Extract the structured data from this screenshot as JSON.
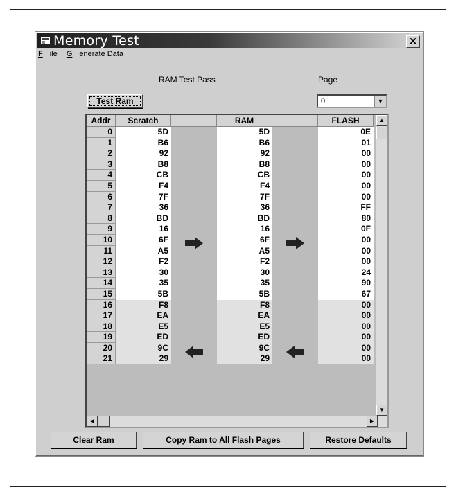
{
  "window": {
    "title": "Memory Test",
    "close_glyph": "×"
  },
  "menu": {
    "file": "File",
    "generate": "Generate Data"
  },
  "labels": {
    "ram_test_pass": "RAM Test Pass",
    "page": "Page"
  },
  "buttons": {
    "test_ram": "Test Ram",
    "clear_ram": "Clear Ram",
    "copy_ram": "Copy Ram to All Flash Pages",
    "restore_defaults": "Restore Defaults"
  },
  "page_select": {
    "value": "0"
  },
  "grid": {
    "headers": {
      "addr": "Addr",
      "scratch": "Scratch",
      "ram": "RAM",
      "flash": "FLASH"
    },
    "rows": [
      {
        "addr": "0",
        "scratch": "5D",
        "ram": "5D",
        "flash": "0E"
      },
      {
        "addr": "1",
        "scratch": "B6",
        "ram": "B6",
        "flash": "01"
      },
      {
        "addr": "2",
        "scratch": "92",
        "ram": "92",
        "flash": "00"
      },
      {
        "addr": "3",
        "scratch": "B8",
        "ram": "B8",
        "flash": "00"
      },
      {
        "addr": "4",
        "scratch": "CB",
        "ram": "CB",
        "flash": "00"
      },
      {
        "addr": "5",
        "scratch": "F4",
        "ram": "F4",
        "flash": "00"
      },
      {
        "addr": "6",
        "scratch": "7F",
        "ram": "7F",
        "flash": "00"
      },
      {
        "addr": "7",
        "scratch": "36",
        "ram": "36",
        "flash": "FF"
      },
      {
        "addr": "8",
        "scratch": "BD",
        "ram": "BD",
        "flash": "80"
      },
      {
        "addr": "9",
        "scratch": "16",
        "ram": "16",
        "flash": "0F"
      },
      {
        "addr": "10",
        "scratch": "6F",
        "ram": "6F",
        "flash": "00"
      },
      {
        "addr": "11",
        "scratch": "A5",
        "ram": "A5",
        "flash": "00"
      },
      {
        "addr": "12",
        "scratch": "F2",
        "ram": "F2",
        "flash": "00"
      },
      {
        "addr": "13",
        "scratch": "30",
        "ram": "30",
        "flash": "24"
      },
      {
        "addr": "14",
        "scratch": "35",
        "ram": "35",
        "flash": "90"
      },
      {
        "addr": "15",
        "scratch": "5B",
        "ram": "5B",
        "flash": "67"
      },
      {
        "addr": "16",
        "scratch": "F8",
        "ram": "F8",
        "flash": "00"
      },
      {
        "addr": "17",
        "scratch": "EA",
        "ram": "EA",
        "flash": "00"
      },
      {
        "addr": "18",
        "scratch": "E5",
        "ram": "E5",
        "flash": "00"
      },
      {
        "addr": "19",
        "scratch": "ED",
        "ram": "ED",
        "flash": "00"
      },
      {
        "addr": "20",
        "scratch": "9C",
        "ram": "9C",
        "flash": "00"
      },
      {
        "addr": "21",
        "scratch": "29",
        "ram": "29",
        "flash": "00"
      }
    ]
  },
  "icons": {
    "title": "window-app-icon",
    "arrow_right": "arrow-right-icon",
    "arrow_left": "arrow-left-icon"
  }
}
